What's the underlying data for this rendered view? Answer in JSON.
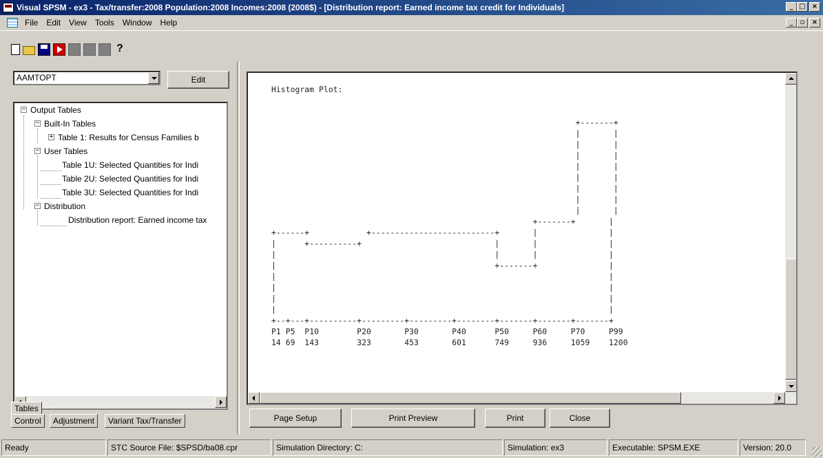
{
  "window": {
    "title": "Visual SPSM - ex3 - Tax/transfer:2008 Population:2008 Incomes:2008 (2008$) - [Distribution report: Earned income tax credit for Individuals]",
    "controls": [
      "minimize",
      "maximize",
      "close"
    ]
  },
  "menu": {
    "items": [
      "File",
      "Edit",
      "View",
      "Tools",
      "Window",
      "Help"
    ]
  },
  "toolbar": {
    "icons": [
      "new-icon",
      "open-icon",
      "save-icon",
      "run-icon",
      "graph1-icon",
      "graph2-icon",
      "stop-icon",
      "help-icon"
    ],
    "help_glyph": "?"
  },
  "left": {
    "combo_value": "AAMTOPT",
    "edit_label": "Edit",
    "tree": {
      "root": "Output Tables",
      "builtin": "Built-In Tables",
      "table1": "Table 1: Results for Census Families b",
      "user": "User Tables",
      "table1u": "Table 1U: Selected Quantities for Indi",
      "table2u": "Table 2U: Selected Quantities for Indi",
      "table3u": "Table 3U: Selected Quantities for Indi",
      "distribution": "Distribution",
      "dist_report": "Distribution report: Earned income tax"
    },
    "tabs": {
      "tables": "Tables",
      "control": "Control",
      "adjustment": "Adjustment",
      "variant": "Variant Tax/Transfer"
    }
  },
  "report": {
    "lines": [
      "Histogram Plot:",
      "",
      "",
      "                                                                +-------+",
      "                                                                |       |",
      "                                                                |       |",
      "                                                                |       |",
      "                                                                |       |",
      "                                                                |       |",
      "                                                                |       |",
      "                                                                |       |",
      "                                                                |       |",
      "                                                       +-------+       |",
      "+------+            +--------------------------+       |               |",
      "|      +----------+                            |       |               |",
      "|                                              |       |               |",
      "|                                              +-------+               |",
      "|                                                                      |",
      "|                                                                      |",
      "|                                                                      |",
      "|                                                                      |",
      "+--+---+----------+---------+---------+--------+-------+-------+-------+",
      "P1 P5  P10        P20       P30       P40      P50     P60     P70     P99",
      "14 69  143        323       453       601      749     936     1059    1200"
    ]
  },
  "buttons": {
    "page_setup": "Page Setup",
    "print_preview": "Print Preview",
    "print": "Print",
    "close": "Close"
  },
  "status": {
    "ready": "Ready",
    "source": "STC Source File: $SPSD/ba08.cpr",
    "simdir": "Simulation Directory: C:",
    "simulation": "Simulation: ex3",
    "executable": "Executable: SPSM.EXE",
    "version": "Version: 20.0"
  }
}
